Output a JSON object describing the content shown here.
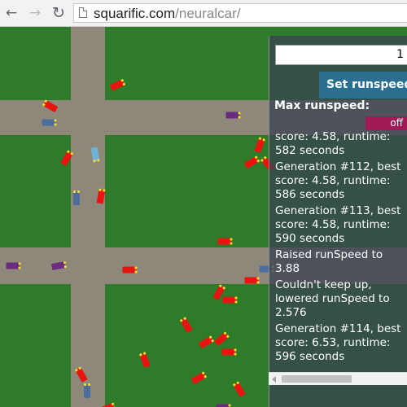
{
  "browser": {
    "back_icon": "arrow-left-icon",
    "forward_icon": "arrow-right-icon",
    "reload_icon": "reload-icon",
    "url_domain": "squarific.com",
    "url_path": "/neuralcar/"
  },
  "panel": {
    "speed_input_value": "1",
    "set_button_label": "Set runspeed",
    "max_runspeed_label": "Max runspeed:",
    "max_runspeed_toggle": "off",
    "log": [
      "score: 4.58, runtime:\n582 seconds",
      "Generation #112, best\nscore: 4.58, runtime:\n586 seconds",
      "Generation #113, best\nscore: 4.58, runtime:\n590 seconds",
      "Raised runSpeed to\n3.88",
      "Couldn't keep up,\nlowered runSpeed to\n2.576",
      "Generation #114, best\nscore: 6.53, runtime:\n596 seconds"
    ]
  },
  "colors": {
    "grass": "#2e7b2a",
    "road": "#8e887b",
    "car_red": "#e8140f",
    "car_blue": "#4d6d9c",
    "car_purple": "#6b2c7f",
    "car_lightblue": "#6fb3d9",
    "headlight": "#f4e025",
    "set_button": "#2a6f8f",
    "toggle_button": "#a01a55"
  }
}
